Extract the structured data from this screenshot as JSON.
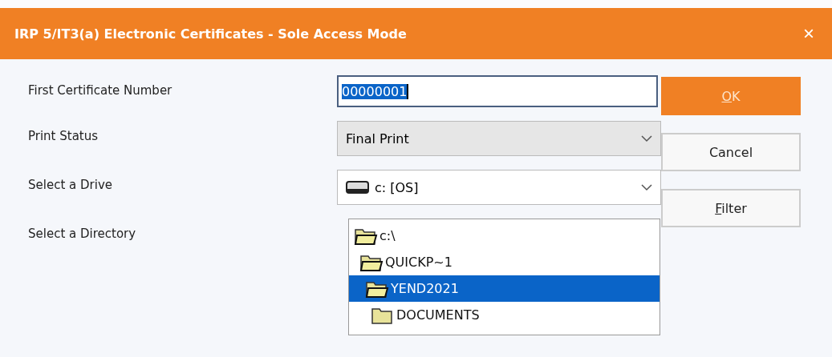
{
  "window": {
    "title": "IRP 5/IT3(a) Electronic Certificates - Sole Access Mode",
    "close": "×"
  },
  "fields": [
    {
      "kind": "text",
      "label": "First Certificate Number",
      "value": "00000001",
      "text_selected": true
    },
    {
      "kind": "select",
      "label": "Print Status",
      "value": "Final Print",
      "disabled": true
    },
    {
      "kind": "drive",
      "label": "Select a Drive",
      "value": "c: [OS]",
      "disabled": false
    },
    {
      "kind": "tree",
      "label": "Select a Directory"
    }
  ],
  "directories": [
    {
      "name": "c:\\",
      "open": true,
      "selected": false,
      "children": [
        {
          "name": "QUICKP~1",
          "open": true,
          "selected": false,
          "children": [
            {
              "name": "YEND2021",
              "open": true,
              "selected": true,
              "children": [
                {
                  "name": "DOCUMENTS",
                  "open": false,
                  "selected": false
                }
              ]
            }
          ]
        }
      ]
    }
  ],
  "buttons": [
    {
      "key": "O",
      "rest": "K",
      "default": true
    },
    {
      "rest": "Cancel",
      "default": false
    },
    {
      "key": "F",
      "rest": "ilter",
      "default": false
    }
  ]
}
